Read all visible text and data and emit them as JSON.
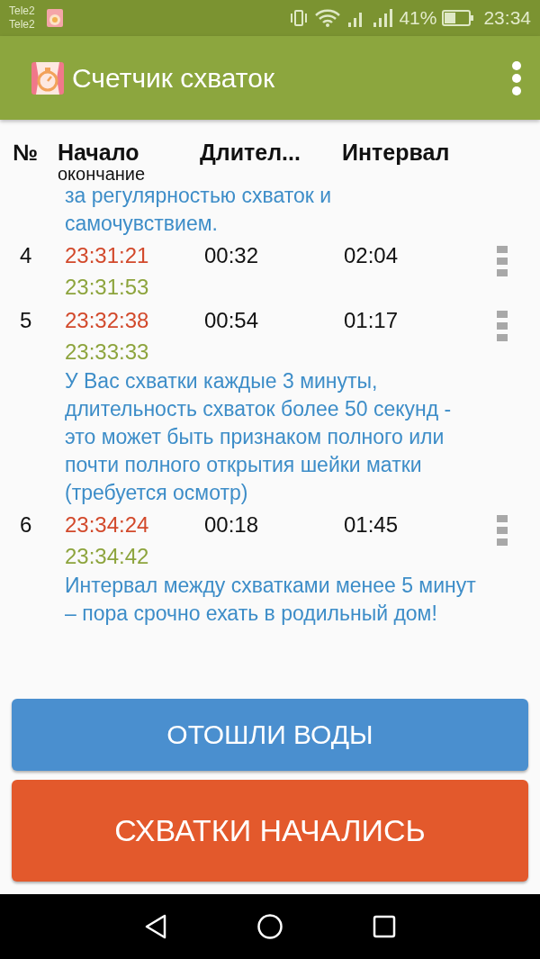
{
  "status_bar": {
    "carriers": [
      "Tele2",
      "Tele2"
    ],
    "battery": "41%",
    "time": "23:34"
  },
  "app_bar": {
    "title": "Счетчик схваток"
  },
  "table": {
    "columns": [
      {
        "label": "№"
      },
      {
        "label": "Начало",
        "sublabel": "окончание"
      },
      {
        "label": "Длител..."
      },
      {
        "label": "Интервал"
      }
    ],
    "rows": [
      {
        "kind": "note",
        "text": "за регулярностью схваток и самочувствием."
      },
      {
        "kind": "contraction",
        "number": "4",
        "start": "23:31:21",
        "end": "23:31:53",
        "duration": "00:32",
        "interval": "02:04"
      },
      {
        "kind": "contraction",
        "number": "5",
        "start": "23:32:38",
        "end": "23:33:33",
        "duration": "00:54",
        "interval": "01:17"
      },
      {
        "kind": "note",
        "text": "У Вас схватки каждые 3 минуты, длительность схваток более 50 секунд - это может быть признаком полного или почти полного открытия шейки матки (требуется осмотр)"
      },
      {
        "kind": "contraction",
        "number": "6",
        "start": "23:34:24",
        "end": "23:34:42",
        "duration": "00:18",
        "interval": "01:45"
      },
      {
        "kind": "note",
        "text": "Интервал между схватками менее 5 минут – пора срочно ехать в родильный дом!"
      }
    ]
  },
  "buttons": [
    {
      "kind": "secondary",
      "label": "ОТОШЛИ ВОДЫ"
    },
    {
      "kind": "primary",
      "label": "СХВАТКИ НАЧАЛИСЬ"
    }
  ]
}
